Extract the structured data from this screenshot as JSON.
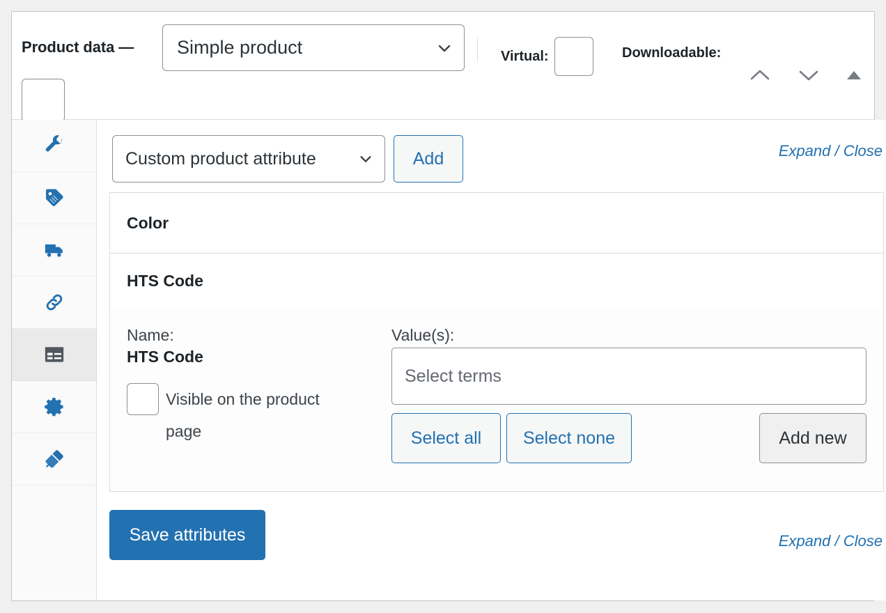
{
  "header": {
    "title": "Product data —",
    "product_type": "Simple product",
    "virtual_label": "Virtual:",
    "downloadable_label": "Downloadable:",
    "move_up_icon": "chevron-up-icon",
    "move_down_icon": "chevron-down-icon",
    "toggle_icon": "triangle-up-icon"
  },
  "rail": {
    "items": [
      {
        "icon": "wrench-icon",
        "active": false
      },
      {
        "icon": "tag-icon",
        "active": false
      },
      {
        "icon": "truck-icon",
        "active": false
      },
      {
        "icon": "link-icon",
        "active": false
      },
      {
        "icon": "attributes-icon",
        "active": true
      },
      {
        "icon": "gear-icon",
        "active": false
      },
      {
        "icon": "plug-icon",
        "active": false
      }
    ]
  },
  "toolbar": {
    "attribute_select_value": "Custom product attribute",
    "add_label": "Add",
    "expand_label": "Expand",
    "separator": "/",
    "close_label": "Close"
  },
  "attributes": [
    {
      "name": "Color",
      "expanded": false
    },
    {
      "name": "HTS Code",
      "expanded": true,
      "name_field_label": "Name:",
      "name_field_value": "HTS Code",
      "visible_label": "Visible on the product page",
      "visible_checked": false,
      "values_label": "Value(s):",
      "terms_placeholder": "Select terms",
      "select_all_label": "Select all",
      "select_none_label": "Select none",
      "add_new_label": "Add new"
    }
  ],
  "footer": {
    "save_label": "Save attributes",
    "expand_label": "Expand",
    "separator": "/",
    "close_label": "Close"
  },
  "colors": {
    "accent": "#2271b1",
    "panel_border": "#c3c4c7",
    "row_border": "#dcdcde",
    "active_rail_bg": "#eaeaea",
    "page_bg": "#f0f0f1"
  }
}
